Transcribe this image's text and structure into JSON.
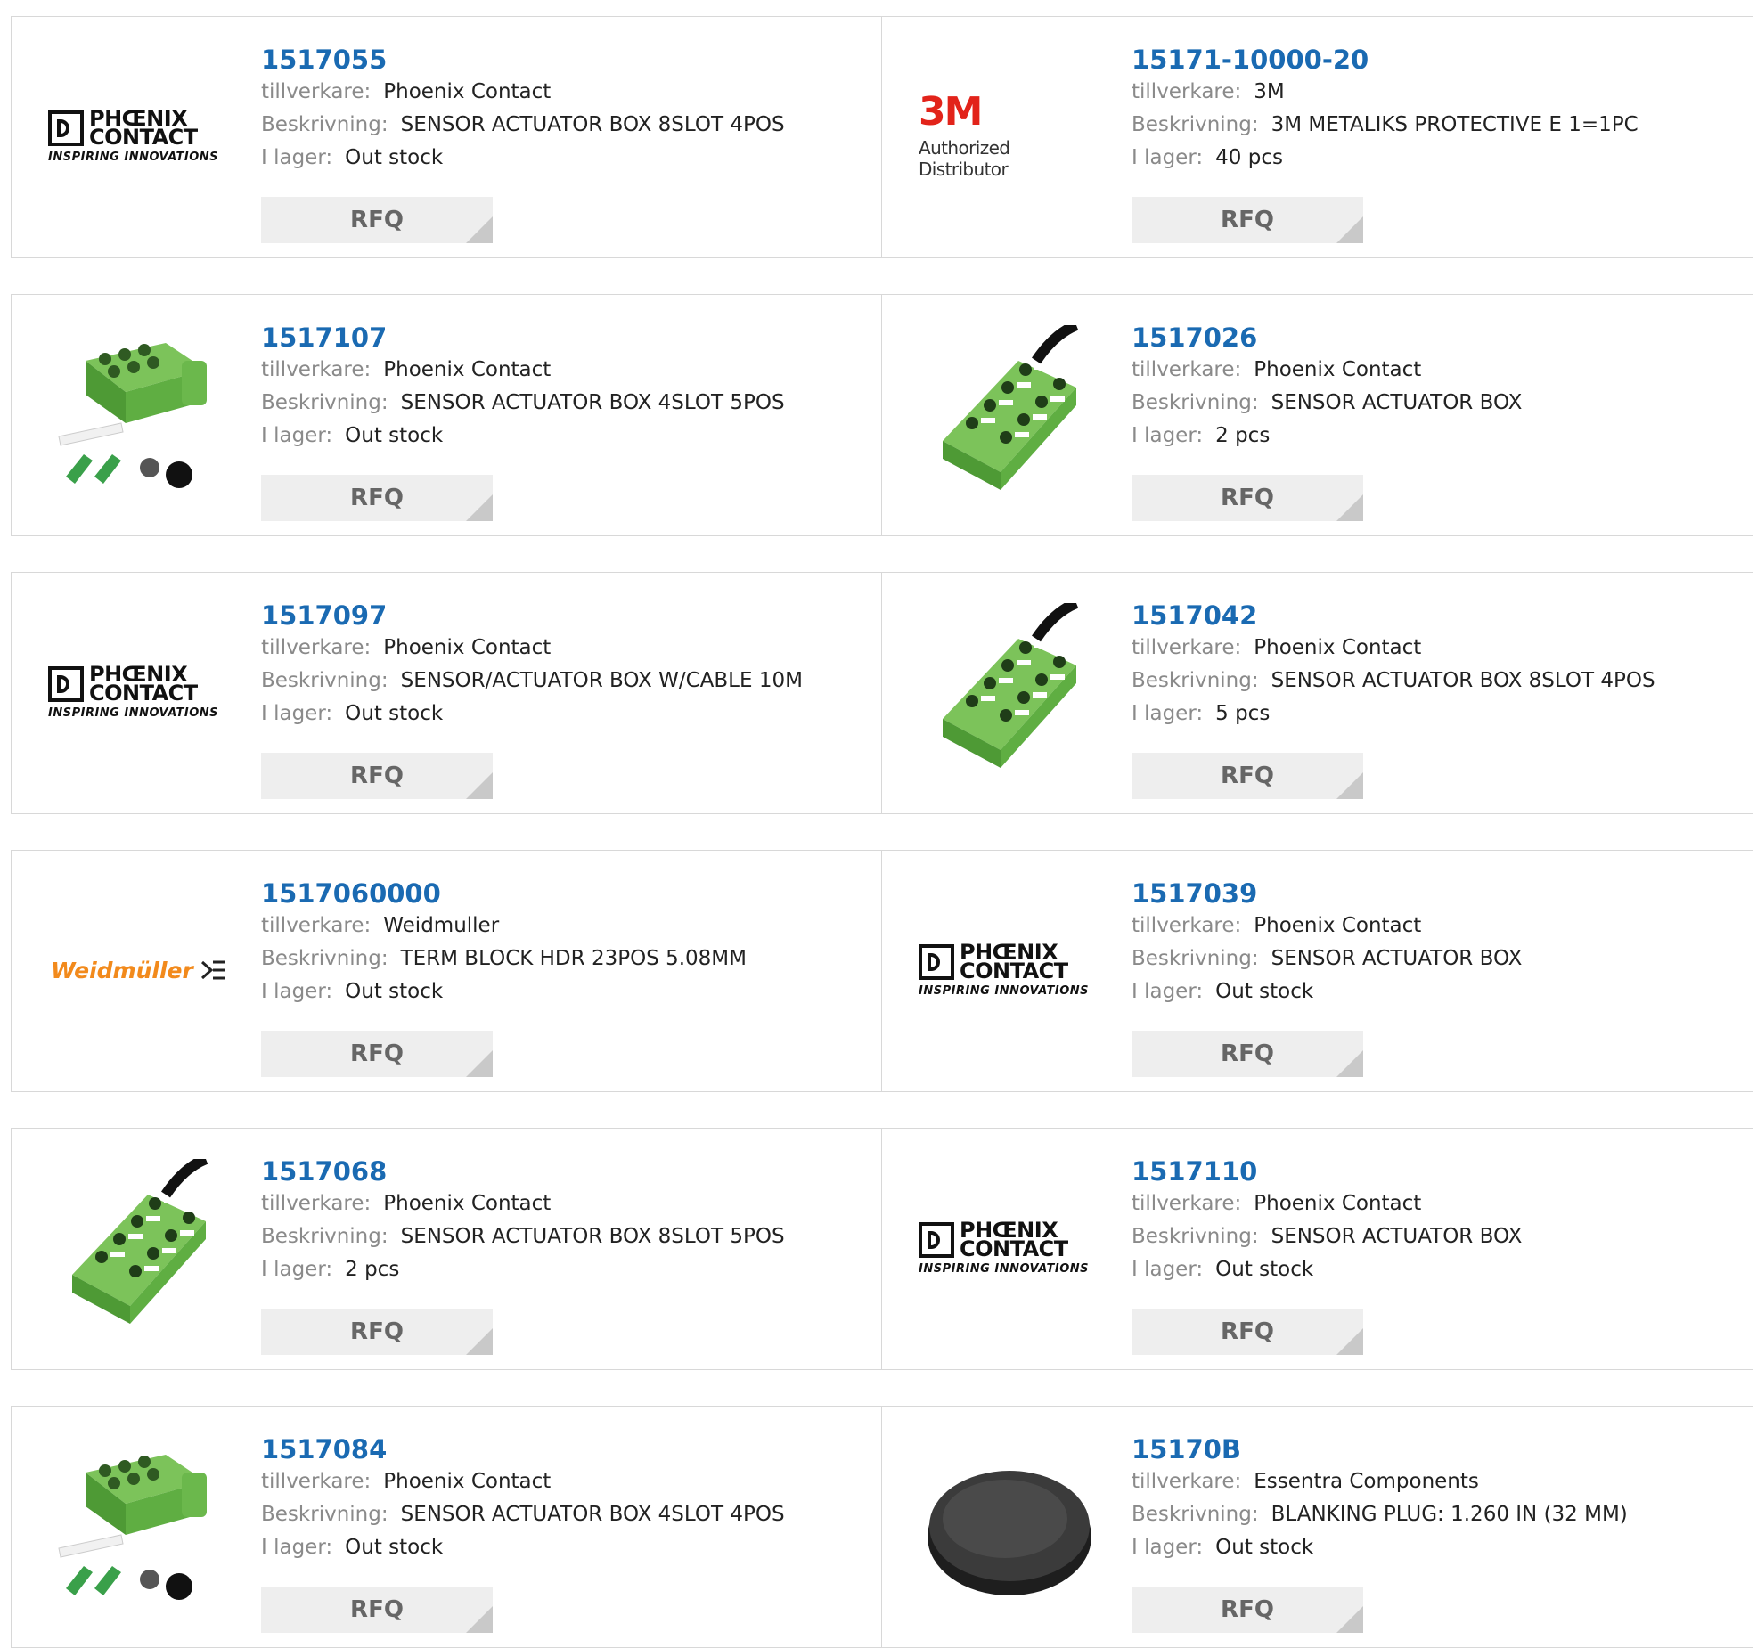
{
  "labels": {
    "manufacturer": "tillverkare:",
    "description": "Beskrivning:",
    "stock": "I lager:",
    "rfq": "RFQ"
  },
  "logos": {
    "phoenix_top": "PHŒNIX",
    "phoenix_bottom": "CONTACT",
    "phoenix_tagline": "INSPIRING INNOVATIONS",
    "mmm": "3M",
    "mmm_sub": "Authorized Distributor",
    "weidmuller": "Weidmüller"
  },
  "colors": {
    "part_link": "#1a6ab2",
    "label_gray": "#8a8a8a",
    "rfq_bg": "#eeeeee",
    "phoenix_green": "#5aa83c",
    "weidmuller_orange": "#f28a1c",
    "mmm_red": "#e2231a"
  },
  "products": [
    {
      "part": "1517055",
      "manufacturer": "Phoenix Contact",
      "description": "SENSOR ACTUATOR BOX 8SLOT 4POS",
      "stock": "Out stock",
      "image": "phoenix-logo"
    },
    {
      "part": "15171-10000-20",
      "manufacturer": "3M",
      "description": "3M METALIKS PROTECTIVE E 1=1PC",
      "stock": "40 pcs",
      "image": "3m-logo"
    },
    {
      "part": "1517107",
      "manufacturer": "Phoenix Contact",
      "description": "SENSOR ACTUATOR BOX 4SLOT 5POS",
      "stock": "Out stock",
      "image": "box-kit"
    },
    {
      "part": "1517026",
      "manufacturer": "Phoenix Contact",
      "description": "SENSOR ACTUATOR BOX",
      "stock": "2 pcs",
      "image": "box-8port"
    },
    {
      "part": "1517097",
      "manufacturer": "Phoenix Contact",
      "description": "SENSOR/ACTUATOR BOX W/CABLE 10M",
      "stock": "Out stock",
      "image": "phoenix-logo"
    },
    {
      "part": "1517042",
      "manufacturer": "Phoenix Contact",
      "description": "SENSOR ACTUATOR BOX 8SLOT 4POS",
      "stock": "5 pcs",
      "image": "box-8port"
    },
    {
      "part": "1517060000",
      "manufacturer": "Weidmuller",
      "description": "TERM BLOCK HDR 23POS 5.08MM",
      "stock": "Out stock",
      "image": "weidmuller-logo"
    },
    {
      "part": "1517039",
      "manufacturer": "Phoenix Contact",
      "description": "SENSOR ACTUATOR BOX",
      "stock": "Out stock",
      "image": "phoenix-logo"
    },
    {
      "part": "1517068",
      "manufacturer": "Phoenix Contact",
      "description": "SENSOR ACTUATOR BOX 8SLOT 5POS",
      "stock": "2 pcs",
      "image": "box-8port"
    },
    {
      "part": "1517110",
      "manufacturer": "Phoenix Contact",
      "description": "SENSOR ACTUATOR BOX",
      "stock": "Out stock",
      "image": "phoenix-logo"
    },
    {
      "part": "1517084",
      "manufacturer": "Phoenix Contact",
      "description": "SENSOR ACTUATOR BOX 4SLOT 4POS",
      "stock": "Out stock",
      "image": "box-kit"
    },
    {
      "part": "15170B",
      "manufacturer": "Essentra Components",
      "description": "BLANKING PLUG: 1.260 IN (32 MM)",
      "stock": "Out stock",
      "image": "plug"
    }
  ]
}
